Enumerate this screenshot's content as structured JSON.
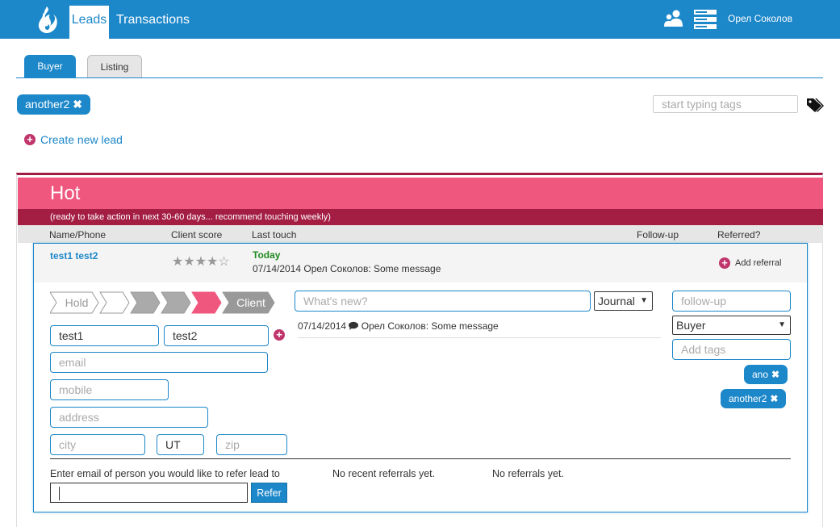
{
  "header": {
    "nav": {
      "leads": "Leads",
      "transactions": "Transactions"
    },
    "user_name": "Орел Соколов"
  },
  "tabs": {
    "buyer": "Buyer",
    "listing": "Listing"
  },
  "filter": {
    "active_tag": "another2",
    "tag_search_placeholder": "start typing tags"
  },
  "create_lead_label": "Create new lead",
  "section": {
    "title": "Hot",
    "subtitle": "(ready to take action in next 30-60 days... recommend touching weekly)",
    "columns": {
      "name_phone": "Name/Phone",
      "client_score": "Client score",
      "last_touch": "Last touch",
      "follow_up": "Follow-up",
      "referred": "Referred?"
    }
  },
  "lead": {
    "name": "test1 test2",
    "score": 4,
    "score_max": 5,
    "last_touch_label": "Today",
    "last_touch_message": "07/14/2014 Орел Соколов: Some message",
    "add_referral": "Add referral",
    "stages": [
      "Hold",
      "",
      "",
      "",
      "",
      "Client"
    ],
    "active_stage_index": 4,
    "first_name": "test1",
    "last_name": "test2",
    "email_placeholder": "email",
    "mobile_placeholder": "mobile",
    "address_placeholder": "address",
    "city_placeholder": "city",
    "state": "UT",
    "zip_placeholder": "zip",
    "note_placeholder": "What's new?",
    "note_type": "Journal",
    "journal_date": "07/14/2014",
    "journal_text": "Орел Соколов: Some message",
    "followup_placeholder": "follow-up",
    "lead_type": "Buyer",
    "add_tags_placeholder": "Add tags",
    "tags": [
      "ano",
      "another2"
    ],
    "refer_label": "Enter email of person you would like to refer lead to",
    "refer_button": "Refer",
    "no_recent_referrals": "No recent referrals yet.",
    "no_referrals": "No referrals yet."
  },
  "colors": {
    "primary": "#1c87c9",
    "hot": "#f0577e",
    "hot_dark": "#a41e44",
    "accent": "#c0356b",
    "success": "#1f8a1f"
  }
}
